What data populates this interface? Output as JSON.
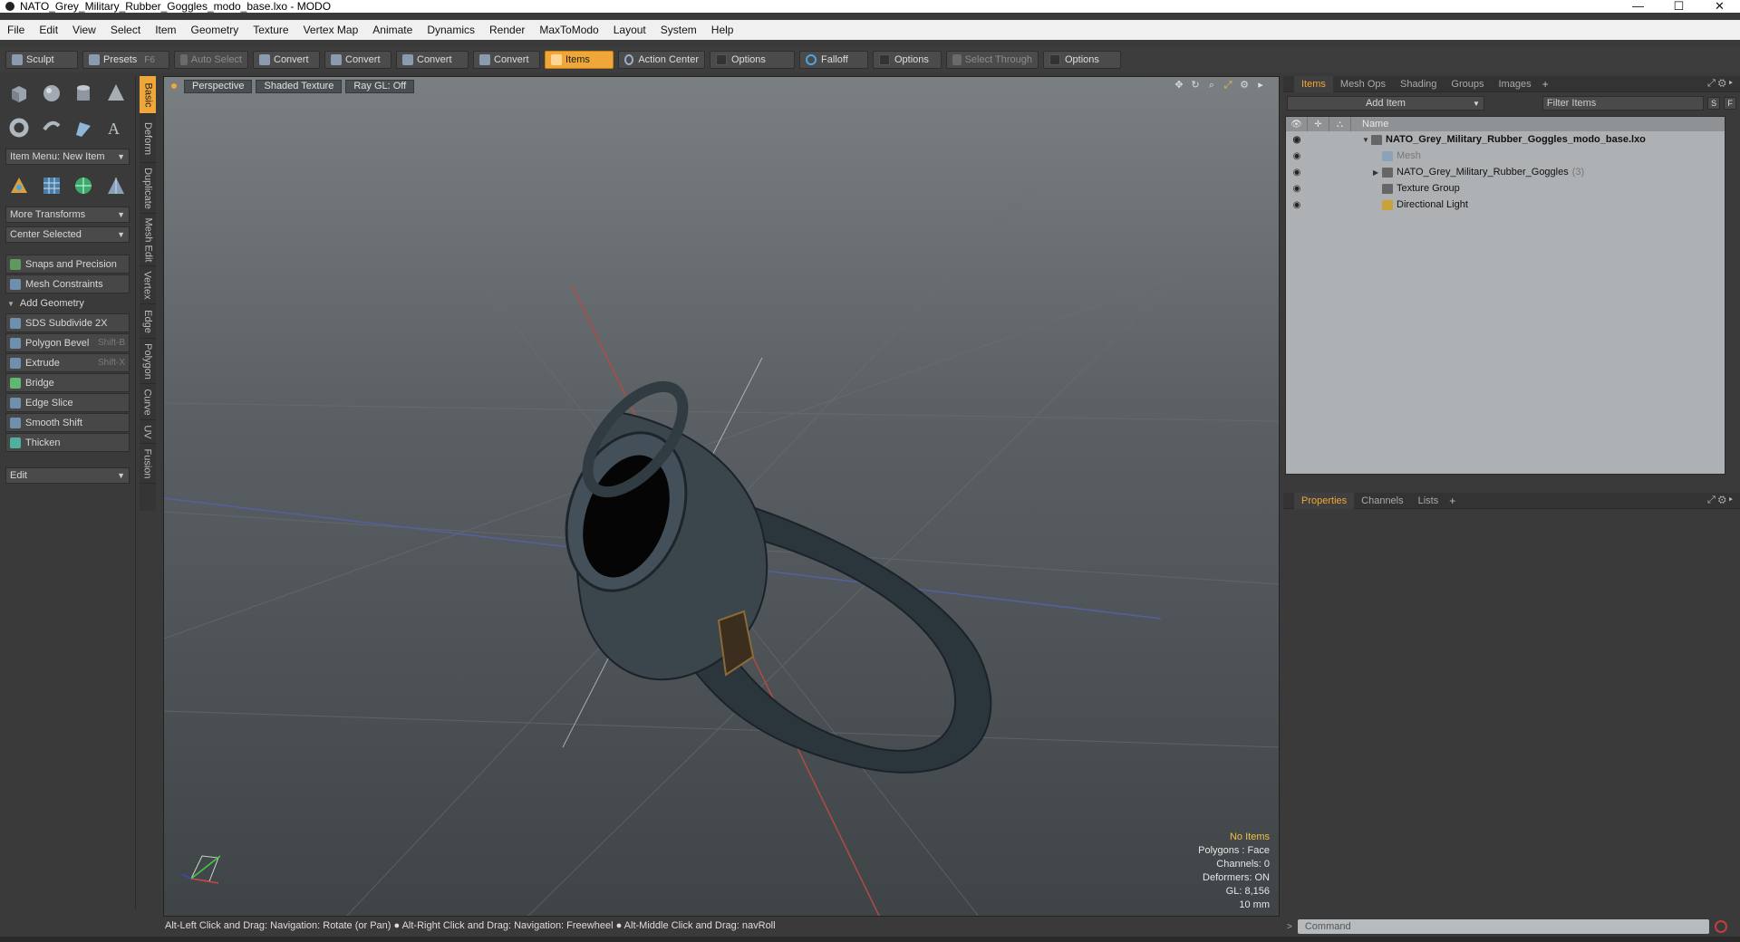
{
  "window": {
    "title": "NATO_Grey_Military_Rubber_Goggles_modo_base.lxo - MODO",
    "min": "—",
    "max": "☐",
    "close": "✕"
  },
  "menu": [
    "File",
    "Edit",
    "View",
    "Select",
    "Item",
    "Geometry",
    "Texture",
    "Vertex Map",
    "Animate",
    "Dynamics",
    "Render",
    "MaxToModo",
    "Layout",
    "System",
    "Help"
  ],
  "toolbar": {
    "sculpt": "Sculpt",
    "presets": "Presets",
    "presets_shortcut": "F6",
    "auto_select": "Auto Select",
    "convert": "Convert",
    "items": "Items",
    "action_center": "Action Center",
    "options": "Options",
    "falloff": "Falloff",
    "select_through": "Select Through"
  },
  "left": {
    "item_menu": "Item Menu: New Item",
    "more_transforms": "More Transforms",
    "center_selected": "Center Selected",
    "snaps": "Snaps and Precision",
    "mesh_constraints": "Mesh Constraints",
    "add_geometry": "Add Geometry",
    "tools": [
      {
        "label": "SDS Subdivide 2X",
        "shortcut": ""
      },
      {
        "label": "Polygon Bevel",
        "shortcut": "Shift-B"
      },
      {
        "label": "Extrude",
        "shortcut": "Shift-X"
      },
      {
        "label": "Bridge",
        "shortcut": ""
      },
      {
        "label": "Edge Slice",
        "shortcut": ""
      },
      {
        "label": "Smooth Shift",
        "shortcut": ""
      },
      {
        "label": "Thicken",
        "shortcut": ""
      }
    ],
    "edit": "Edit"
  },
  "vtabs": [
    "Basic",
    "Deform",
    "Duplicate",
    "Mesh Edit",
    "Vertex",
    "Edge",
    "Polygon",
    "Curve",
    "UV",
    "Fusion"
  ],
  "viewport": {
    "perspective": "Perspective",
    "shaded": "Shaded Texture",
    "raygl": "Ray GL: Off",
    "info": {
      "items": "No Items",
      "polygons": "Polygons : Face",
      "channels": "Channels: 0",
      "deformers": "Deformers: ON",
      "gl": "GL: 8,156",
      "scale": "10 mm"
    }
  },
  "status": "Alt-Left Click and Drag: Navigation: Rotate (or Pan) ● Alt-Right Click and Drag: Navigation: Freewheel ● Alt-Middle Click and Drag: navRoll",
  "right": {
    "tabs": [
      "Items",
      "Mesh Ops",
      "Shading",
      "Groups",
      "Images"
    ],
    "add_item": "Add Item",
    "filter": "Filter Items",
    "s": "S",
    "f": "F",
    "name_col": "Name",
    "tree": [
      {
        "label": "NATO_Grey_Military_Rubber_Goggles_modo_base.lxo",
        "count": ""
      },
      {
        "label": "Mesh",
        "count": ""
      },
      {
        "label": "NATO_Grey_Military_Rubber_Goggles",
        "count": "(3)"
      },
      {
        "label": "Texture Group",
        "count": ""
      },
      {
        "label": "Directional Light",
        "count": ""
      }
    ],
    "lower_tabs": [
      "Properties",
      "Channels",
      "Lists"
    ],
    "command": "Command"
  }
}
